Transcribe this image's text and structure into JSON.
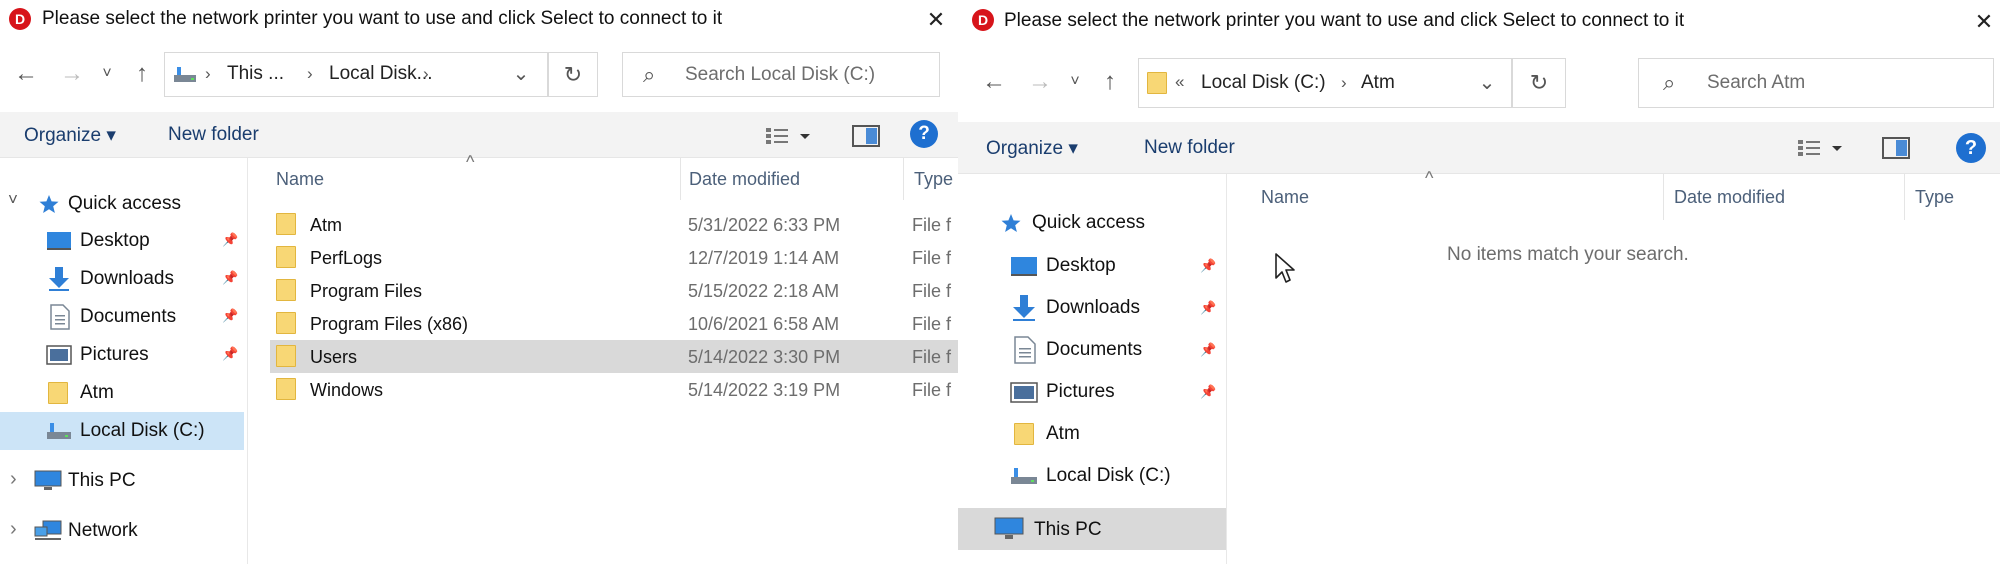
{
  "left": {
    "title": "Please select the network printer you want to use and click Select to connect to it",
    "breadcrumb": [
      "This ...",
      "Local Disk..."
    ],
    "search_placeholder": "Search Local Disk (C:)",
    "organize_label": "Organize ▾",
    "new_folder_label": "New folder",
    "nav": {
      "quick_access": "Quick access",
      "desktop": "Desktop",
      "downloads": "Downloads",
      "documents": "Documents",
      "pictures": "Pictures",
      "atm": "Atm",
      "local_disk": "Local Disk (C:)",
      "this_pc": "This PC",
      "network": "Network"
    },
    "columns": {
      "name": "Name",
      "date": "Date modified",
      "type": "Type"
    },
    "files": [
      {
        "name": "Atm",
        "date": "5/31/2022 6:33 PM",
        "type": "File f"
      },
      {
        "name": "PerfLogs",
        "date": "12/7/2019 1:14 AM",
        "type": "File f"
      },
      {
        "name": "Program Files",
        "date": "5/15/2022 2:18 AM",
        "type": "File f"
      },
      {
        "name": "Program Files (x86)",
        "date": "10/6/2021 6:58 AM",
        "type": "File f"
      },
      {
        "name": "Users",
        "date": "5/14/2022 3:30 PM",
        "type": "File f"
      },
      {
        "name": "Windows",
        "date": "5/14/2022 3:19 PM",
        "type": "File f"
      }
    ]
  },
  "right": {
    "title": "Please select the network printer you want to use and click Select to connect to it",
    "breadcrumb": [
      "Local Disk (C:)",
      "Atm"
    ],
    "search_placeholder": "Search Atm",
    "organize_label": "Organize ▾",
    "new_folder_label": "New folder",
    "nav": {
      "quick_access": "Quick access",
      "desktop": "Desktop",
      "downloads": "Downloads",
      "documents": "Documents",
      "pictures": "Pictures",
      "atm": "Atm",
      "local_disk": "Local Disk (C:)",
      "this_pc": "This PC"
    },
    "columns": {
      "name": "Name",
      "date": "Date modified",
      "type": "Type"
    },
    "empty_message": "No items match your search."
  },
  "icons": {
    "logo": "D",
    "close": "✕",
    "back": "←",
    "forward": "→",
    "recent": "˅",
    "up": "↑",
    "dropdown": "⌄",
    "refresh": "↻",
    "search": "⌕",
    "expand": "˅",
    "collapse": "›",
    "pin": "📌",
    "sort_up": "^",
    "overflow": "«",
    "help": "?"
  },
  "colors": {
    "logo": "#d7141a",
    "help": "#1e6fd0",
    "folder": "#f8d775",
    "selection_blue": "#cce4f7",
    "selection_gray": "#d9d9d9",
    "command_text": "#1a3d6e"
  }
}
